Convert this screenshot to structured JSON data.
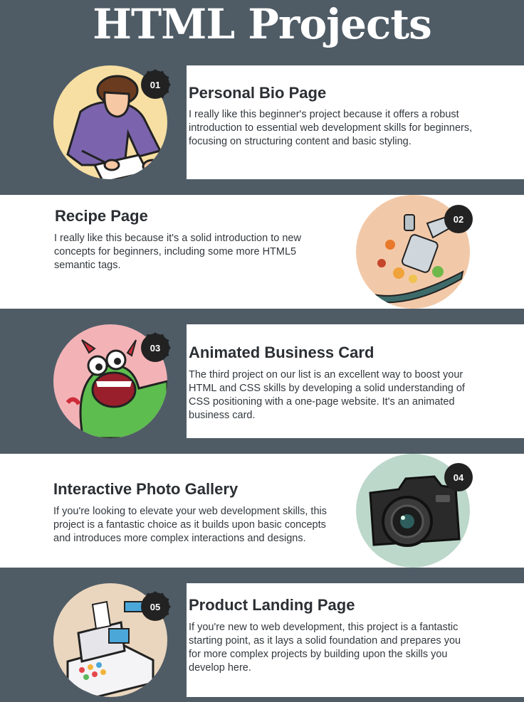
{
  "page": {
    "title": "HTML Projects"
  },
  "projects": [
    {
      "number": "01",
      "title": "Personal Bio Page",
      "description": "I really like this beginner's project because it offers a robust introduction to essential web development skills for beginners, focusing on structuring content and basic styling.",
      "image": "person-writing-illustration",
      "circle_color": "#f7dfa3"
    },
    {
      "number": "02",
      "title": "Recipe Page",
      "description": "I really like this because it's a solid introduction to new concepts for beginners, including some more HTML5 semantic tags.",
      "image": "frying-pan-illustration",
      "circle_color": "#f2c9a8"
    },
    {
      "number": "03",
      "title": "Animated Business Card",
      "description": "The third project on our list is an excellent way to boost your HTML and CSS skills by developing a solid understanding of CSS positioning with a one-page website. It's an animated business card.",
      "image": "green-monster-illustration",
      "circle_color": "#f3b3b6"
    },
    {
      "number": "04",
      "title": "Interactive Photo Gallery",
      "description": "If you're looking to elevate your web development skills, this project is a fantastic choice as it builds upon basic concepts and introduces more complex interactions and designs.",
      "image": "camera-illustration",
      "circle_color": "#bcd8cb"
    },
    {
      "number": "05",
      "title": "Product Landing Page",
      "description": "If you're new to web development, this project is a fantastic starting point, as it lays a solid foundation and prepares you for more complex projects by building upon the skills you develop here.",
      "image": "cash-register-illustration",
      "circle_color": "#ead6be"
    }
  ]
}
